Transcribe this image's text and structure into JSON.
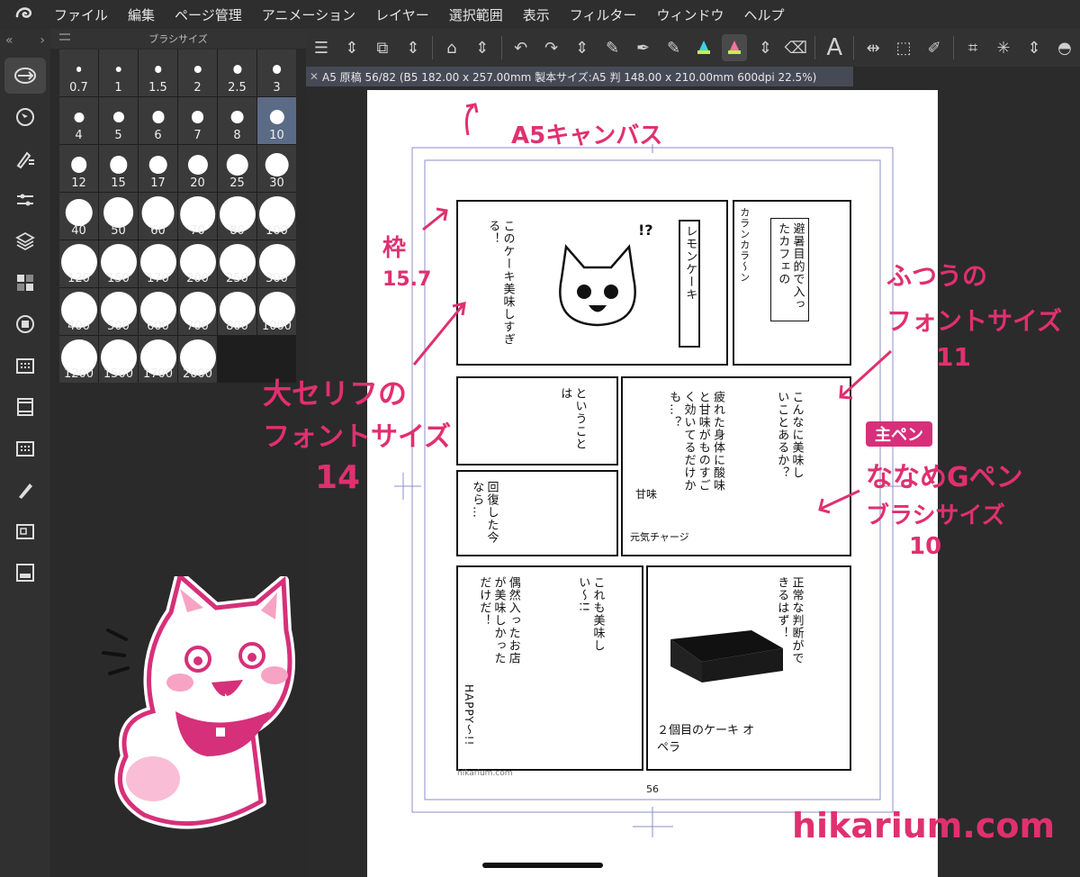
{
  "menu": {
    "items": [
      "ファイル",
      "編集",
      "ページ管理",
      "アニメーション",
      "レイヤー",
      "選択範囲",
      "表示",
      "フィルター",
      "ウィンドウ",
      "ヘルプ"
    ]
  },
  "palette": {
    "title": "ブラシサイズ",
    "sizes": [
      "0.7",
      "1",
      "1.5",
      "2",
      "2.5",
      "3",
      "4",
      "5",
      "6",
      "7",
      "8",
      "10",
      "12",
      "15",
      "17",
      "20",
      "25",
      "30",
      "40",
      "50",
      "60",
      "70",
      "80",
      "100",
      "120",
      "150",
      "170",
      "200",
      "250",
      "300",
      "400",
      "500",
      "600",
      "700",
      "800",
      "1000",
      "1200",
      "1500",
      "1700",
      "2000"
    ],
    "selected": "10"
  },
  "document": {
    "info": "A5 原稿 56/82 (B5 182.00 x 257.00mm 製本サイズ:A5 判 148.00 x 210.00mm 600dpi 22.5%)",
    "page_number": "56",
    "credit": "hikarium.com"
  },
  "manga": {
    "p1_bubble_left": "このケーキ美味しすぎる！",
    "p1_sign": "レモンケーキ",
    "p1_sfx": "!?",
    "p2_bubble": "避暑目的で入ったカフェの",
    "p2_sfx1": "カランカラ〜ン",
    "p3_bubble": "ということは",
    "p4_bubble_main": "疲れた身体に酸味と甘味がものすごく効いてるだけかも…？",
    "p4_bubble_right": "こんなに美味しいことあるか？",
    "p4_label1": "甘味",
    "p4_label2": "元気チャージ",
    "p5_bubble": "回復した今なら…",
    "p6_bubble_a": "偶然入ったお店が美味しかっただけだ！",
    "p6_bubble_b": "これも美味しい〜!!",
    "p6_sfx": "HAPPY〜!!",
    "p7_bubble": "正常な判断ができるはず！",
    "p7_caption": "２個目のケーキ オペラ"
  },
  "annotations": {
    "canvas": "A5キャンバス",
    "frame_title": "枠",
    "frame_value": "15.7",
    "big_line_1": "大セリフの",
    "big_line_2": "フォントサイズ",
    "big_line_3": "14",
    "normal_line_1": "ふつうの",
    "normal_line_2": "フォントサイズ",
    "normal_line_3": "11",
    "pen_badge": "主ペン",
    "pen_line_1": "ななめGペン",
    "pen_line_2": "ブラシサイズ",
    "pen_line_3": "10",
    "site": "hikarium.com"
  },
  "colors": {
    "accent": "#e0306f",
    "badge": "#d6307a",
    "ui_bg": "#2b2b2b",
    "selected_cell": "#5b6b86"
  }
}
